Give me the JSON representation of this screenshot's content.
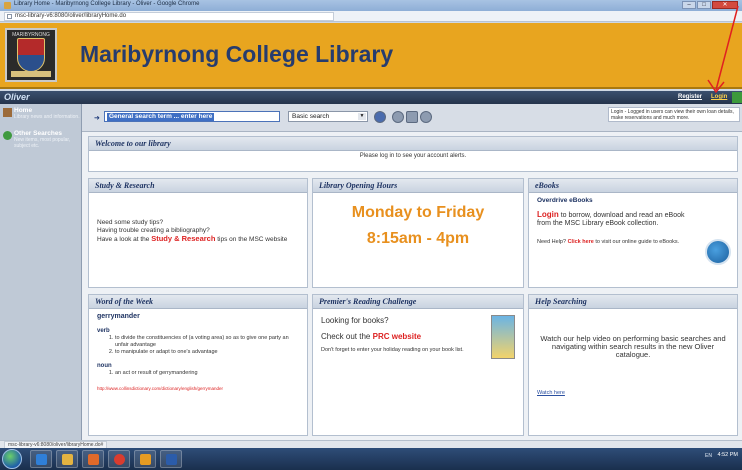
{
  "browser": {
    "window_title": "Library Home - Maribyrnong College Library - Oliver - Google Chrome",
    "url": "msc-library-v6:8080/oliver/libraryHome.do"
  },
  "banner": {
    "title": "Maribyrnong College Library",
    "crest_motto": "MARIBYRNONG"
  },
  "navbar": {
    "brand": "Oliver",
    "register": "Register",
    "login": "Login"
  },
  "sidebar": {
    "items": [
      {
        "label": "Home",
        "sub": "Library news and information."
      },
      {
        "label": "Other Searches",
        "sub": "New items, most popular, subject etc."
      }
    ]
  },
  "search": {
    "placeholder": "General search term ... enter here",
    "mode": "Basic search",
    "login_help": "Login - Logged in users can view their own loan details, make reservations and much more."
  },
  "welcome": {
    "title": "Welcome to our library",
    "message": "Please log in to see your account alerts."
  },
  "study": {
    "title": "Study & Research",
    "line1": "Need some study tips?",
    "line2": "Having trouble creating a bibliography?",
    "line3": "Have a look at the",
    "link": "Study & Research",
    "line4": "tips on the MSC website"
  },
  "hours": {
    "title": "Library Opening Hours",
    "days": "Monday to Friday",
    "time": "8:15am - 4pm"
  },
  "ebooks": {
    "title": "eBooks",
    "sub": "Overdrive eBooks",
    "login": "Login",
    "text": "to borrow, download and read an eBook from the MSC Library eBook collection.",
    "help_prefix": "Need Help?",
    "click_here": "Click here",
    "help_suffix": "to visit our online guide to eBooks."
  },
  "word": {
    "title": "Word of the Week",
    "term": "gerrymander",
    "pos_verb": "verb",
    "defs_verb": [
      "to divide the constituencies of (a voting area) so as to give one party an unfair advantage",
      "to manipulate or adapt to one's advantage"
    ],
    "pos_noun": "noun",
    "defs_noun": [
      "an act or result of gerrymandering"
    ],
    "source": "http://www.collinsdictionary.com/dictionary/english/gerrymander"
  },
  "prc": {
    "title": "Premier's Reading Challenge",
    "question": "Looking for books?",
    "check_prefix": "Check out the",
    "check_link": "PRC website",
    "note": "Don't forget to enter your holiday reading on your book list."
  },
  "helpsearch": {
    "title": "Help Searching",
    "message": "Watch our help video on performing basic searches and navigating within search results in the new Oliver catalogue.",
    "watch": "Watch here"
  },
  "statusbar": {
    "text": "msc-library-v6:8080/oliver/libraryHome.do#"
  },
  "taskbar": {
    "tray": "EN",
    "time": "4:52 PM"
  },
  "colors": {
    "banner": "#e8a51f",
    "title": "#263c6e",
    "accent_red": "#d22222",
    "hours_orange": "#e8901e"
  }
}
